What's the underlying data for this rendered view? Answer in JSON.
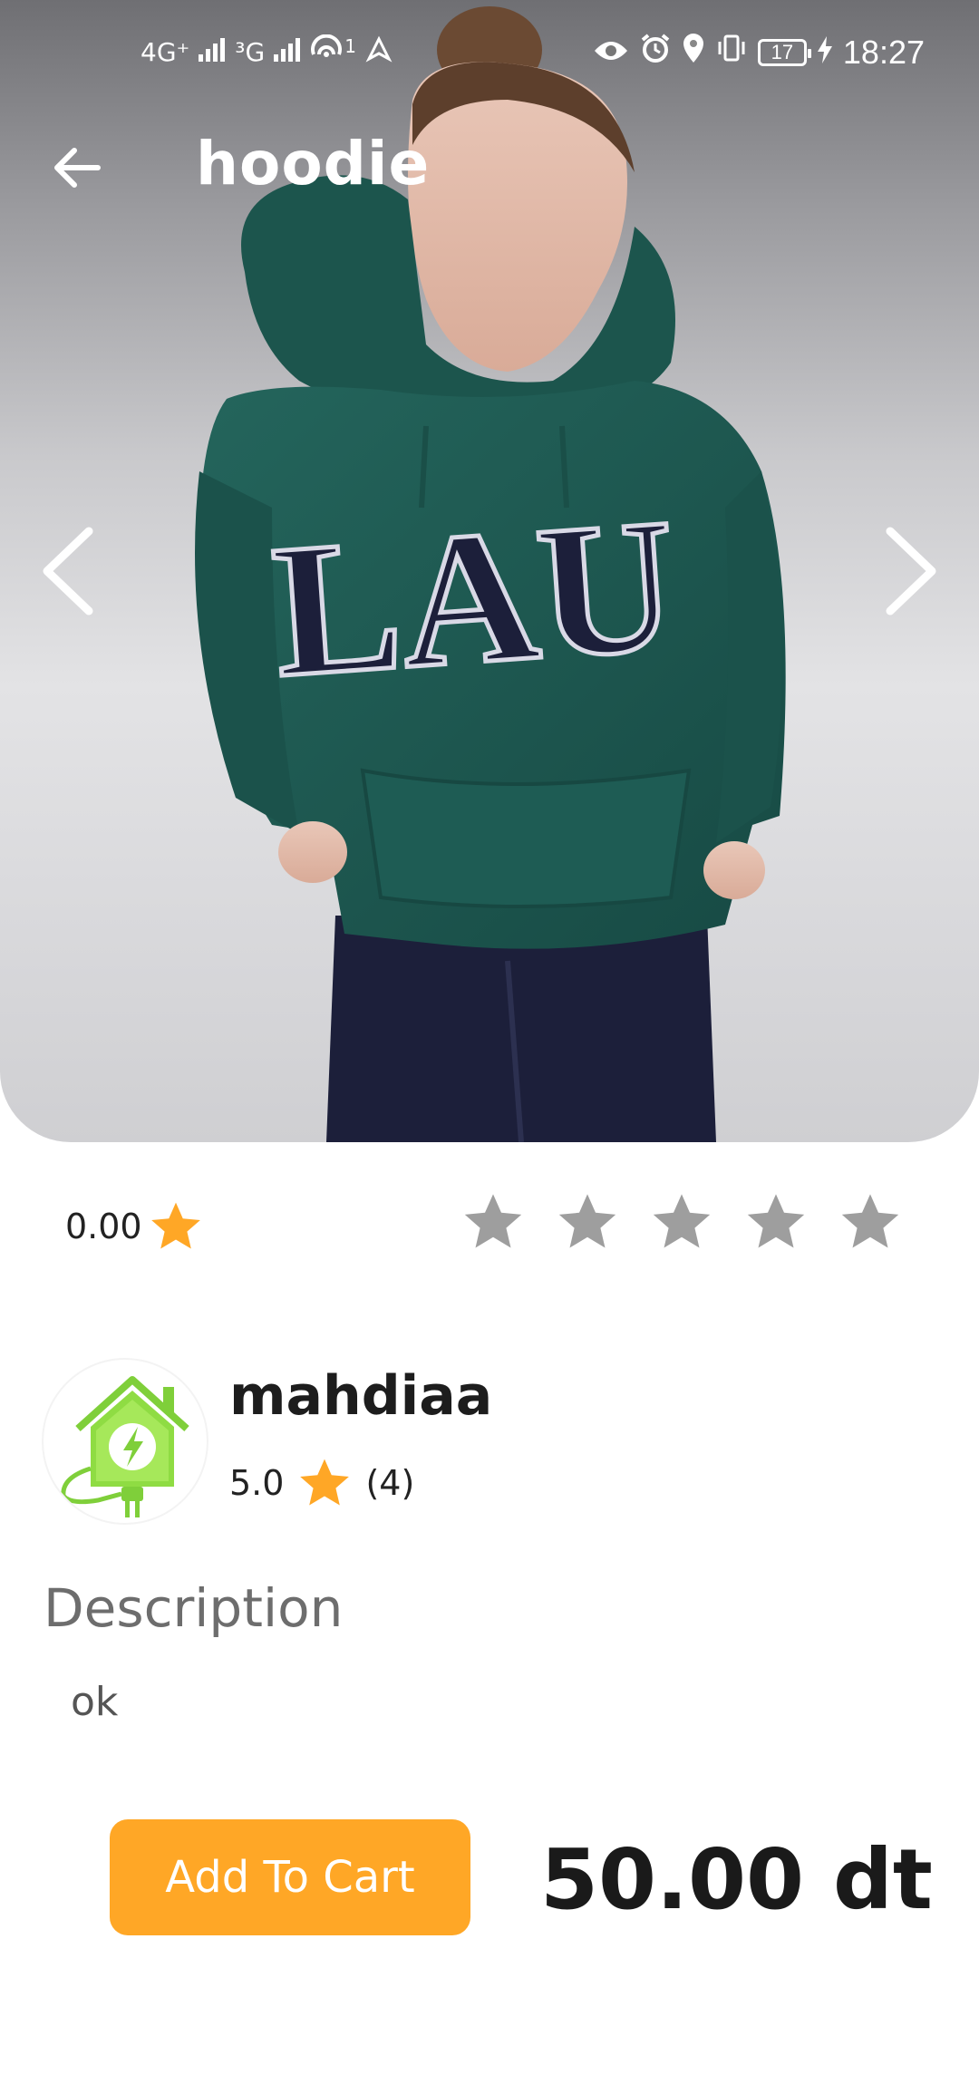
{
  "status_bar": {
    "network_1": "4G⁺",
    "network_2": "³G",
    "hotspot_count": "1",
    "battery_level": "17",
    "time": "18:27"
  },
  "header": {
    "title": "hoodie"
  },
  "product": {
    "image_print_text": "LAU",
    "rating_value": "0.00",
    "rate_star_count": 5
  },
  "seller": {
    "name": "mahdiaa",
    "rating": "5.0",
    "review_count": "(4)"
  },
  "description": {
    "title": "Description",
    "text": "ok"
  },
  "footer": {
    "add_to_cart_label": "Add To Cart",
    "price": "50.00 dt"
  },
  "colors": {
    "accent": "#ffa726",
    "star_empty": "#9e9e9e",
    "hoodie": "#1f5a52",
    "pants": "#1c1f3a"
  }
}
